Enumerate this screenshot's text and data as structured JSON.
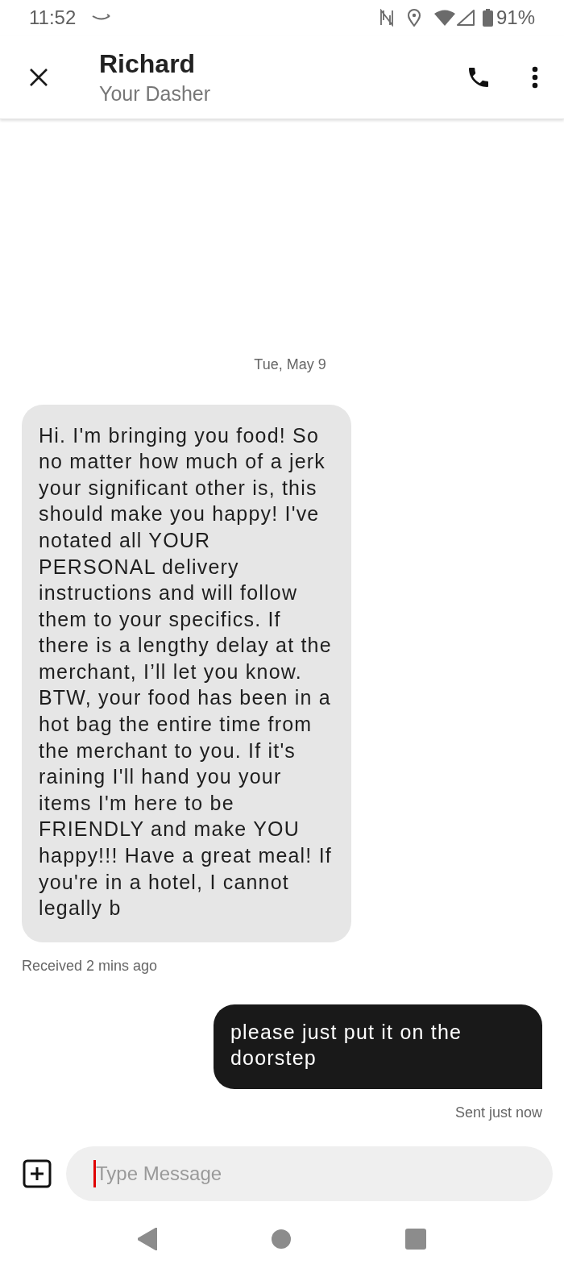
{
  "status_bar": {
    "time": "11:52",
    "battery": "91%"
  },
  "header": {
    "name": "Richard",
    "subtitle": "Your Dasher"
  },
  "date_divider": "Tue, May 9",
  "messages": [
    {
      "kind": "received",
      "text": "Hi. I'm bringing you food! So no matter how much of a jerk your significant other is, this should make you happy! I've notated all YOUR PERSONAL delivery instructions and will follow them to your specifics. If there is a lengthy delay at the merchant, I’ll let you know. BTW, your food has been in a hot bag the entire time from the merchant to you. If it's raining I'll hand you your items I'm here to be FRIENDLY and make YOU happy!!! Have a great meal! If you're in a hotel, I cannot legally b",
      "meta": "Received 2 mins ago"
    },
    {
      "kind": "sent",
      "text": "please just put it on the doorstep",
      "meta": "Sent just now"
    }
  ],
  "composer": {
    "placeholder": "Type Message"
  }
}
